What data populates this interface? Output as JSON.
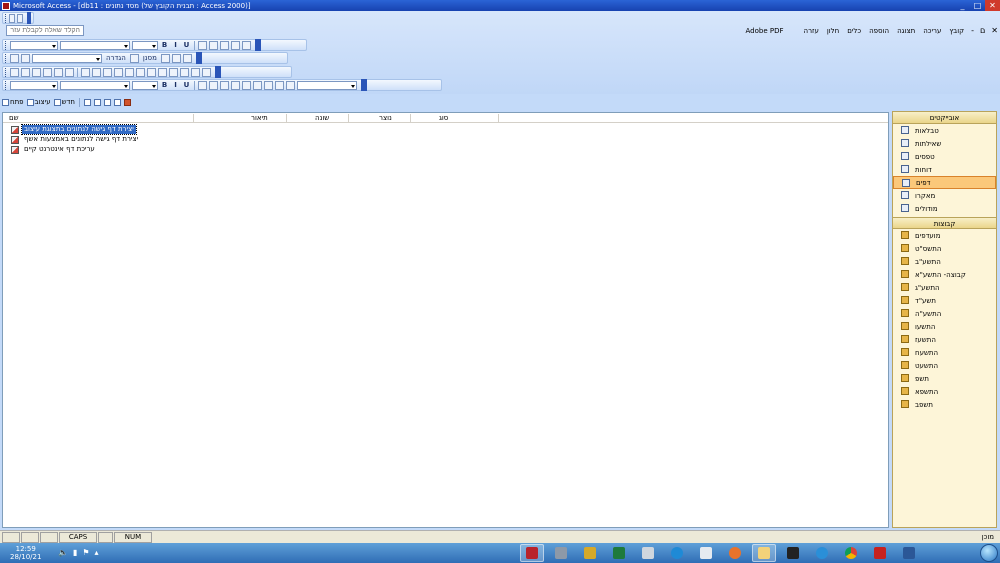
{
  "window": {
    "title": "Microsoft Access - [db11 : מסד נתונים (תבנית הקובץ של : Access 2000)]",
    "controls": [
      "_",
      "□",
      "✕"
    ]
  },
  "ask_box": {
    "placeholder": "הקלד שאלה לקבלת עזרה"
  },
  "menubar": {
    "items": [
      "קובץ",
      "עריכה",
      "תצוגה",
      "הוספה",
      "כלים",
      "חלון",
      "עזרה",
      "Adobe PDF"
    ],
    "doc_controls": [
      "✕",
      "ם",
      "-"
    ]
  },
  "toolbar": {
    "bold": "B",
    "italic": "I",
    "underline": "U",
    "close_label": "הגדרה",
    "filter_label": "מסנן"
  },
  "db_toolbar": {
    "open_label": "פתח",
    "design_label": "עיצוב",
    "new_label": "חדש"
  },
  "list": {
    "columns": [
      "שם",
      "תיאור",
      "שונה",
      "נוצר",
      "סוג"
    ],
    "rows": [
      {
        "label": "יצירת דף גישה לנתונים בתצוגת עיצוב",
        "selected": true
      },
      {
        "label": "יצירת דף גישה לנתונים באמצעות אשף",
        "selected": false
      },
      {
        "label": "עריכת דף אינטרנט קיים",
        "selected": false
      }
    ]
  },
  "objects_bar": {
    "header": "אובייקטים",
    "items": [
      {
        "label": "טבלאות",
        "icon": "table-icon",
        "active": false
      },
      {
        "label": "שאילתות",
        "icon": "query-icon",
        "active": false
      },
      {
        "label": "טפסים",
        "icon": "form-icon",
        "active": false
      },
      {
        "label": "דוחות",
        "icon": "report-icon",
        "active": false
      },
      {
        "label": "דפים",
        "icon": "page-icon",
        "active": true
      },
      {
        "label": "מאקרו",
        "icon": "macro-icon",
        "active": false
      },
      {
        "label": "מודולים",
        "icon": "module-icon",
        "active": false
      }
    ],
    "groups_header": "קבוצות",
    "groups": [
      "מועדפים",
      "התשס\"ט",
      "התשע\"ב",
      "קבוצה- התשע\"א",
      "התשע\"ג",
      "תשע\"ד",
      "התשע\"ה",
      "התשעו",
      "התשעז",
      "התשעח",
      "התשעט",
      "תשפ",
      "התשפא",
      "תשפב"
    ]
  },
  "statusbar": {
    "ready": "מוכן",
    "caps": "CAPS",
    "num": "NUM"
  },
  "taskbar": {
    "time": "12:59",
    "date": "28/10/21"
  },
  "colors": {
    "titlebar": "#1742b0",
    "selection": "#316ac5",
    "active_object": "#fbc87a"
  }
}
